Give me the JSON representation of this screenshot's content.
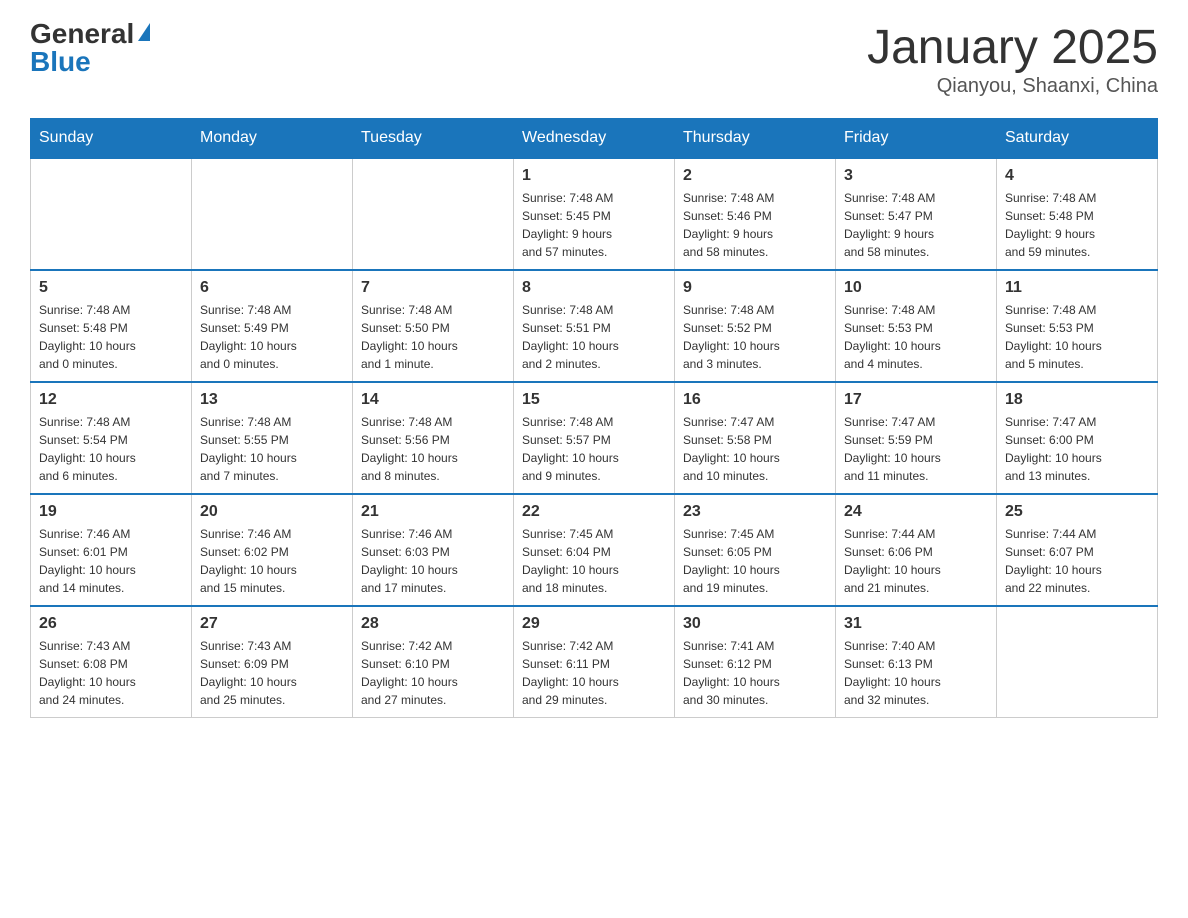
{
  "logo": {
    "general": "General",
    "blue": "Blue"
  },
  "header": {
    "month": "January 2025",
    "location": "Qianyou, Shaanxi, China"
  },
  "days_of_week": [
    "Sunday",
    "Monday",
    "Tuesday",
    "Wednesday",
    "Thursday",
    "Friday",
    "Saturday"
  ],
  "weeks": [
    [
      {
        "day": "",
        "info": ""
      },
      {
        "day": "",
        "info": ""
      },
      {
        "day": "",
        "info": ""
      },
      {
        "day": "1",
        "info": "Sunrise: 7:48 AM\nSunset: 5:45 PM\nDaylight: 9 hours\nand 57 minutes."
      },
      {
        "day": "2",
        "info": "Sunrise: 7:48 AM\nSunset: 5:46 PM\nDaylight: 9 hours\nand 58 minutes."
      },
      {
        "day": "3",
        "info": "Sunrise: 7:48 AM\nSunset: 5:47 PM\nDaylight: 9 hours\nand 58 minutes."
      },
      {
        "day": "4",
        "info": "Sunrise: 7:48 AM\nSunset: 5:48 PM\nDaylight: 9 hours\nand 59 minutes."
      }
    ],
    [
      {
        "day": "5",
        "info": "Sunrise: 7:48 AM\nSunset: 5:48 PM\nDaylight: 10 hours\nand 0 minutes."
      },
      {
        "day": "6",
        "info": "Sunrise: 7:48 AM\nSunset: 5:49 PM\nDaylight: 10 hours\nand 0 minutes."
      },
      {
        "day": "7",
        "info": "Sunrise: 7:48 AM\nSunset: 5:50 PM\nDaylight: 10 hours\nand 1 minute."
      },
      {
        "day": "8",
        "info": "Sunrise: 7:48 AM\nSunset: 5:51 PM\nDaylight: 10 hours\nand 2 minutes."
      },
      {
        "day": "9",
        "info": "Sunrise: 7:48 AM\nSunset: 5:52 PM\nDaylight: 10 hours\nand 3 minutes."
      },
      {
        "day": "10",
        "info": "Sunrise: 7:48 AM\nSunset: 5:53 PM\nDaylight: 10 hours\nand 4 minutes."
      },
      {
        "day": "11",
        "info": "Sunrise: 7:48 AM\nSunset: 5:53 PM\nDaylight: 10 hours\nand 5 minutes."
      }
    ],
    [
      {
        "day": "12",
        "info": "Sunrise: 7:48 AM\nSunset: 5:54 PM\nDaylight: 10 hours\nand 6 minutes."
      },
      {
        "day": "13",
        "info": "Sunrise: 7:48 AM\nSunset: 5:55 PM\nDaylight: 10 hours\nand 7 minutes."
      },
      {
        "day": "14",
        "info": "Sunrise: 7:48 AM\nSunset: 5:56 PM\nDaylight: 10 hours\nand 8 minutes."
      },
      {
        "day": "15",
        "info": "Sunrise: 7:48 AM\nSunset: 5:57 PM\nDaylight: 10 hours\nand 9 minutes."
      },
      {
        "day": "16",
        "info": "Sunrise: 7:47 AM\nSunset: 5:58 PM\nDaylight: 10 hours\nand 10 minutes."
      },
      {
        "day": "17",
        "info": "Sunrise: 7:47 AM\nSunset: 5:59 PM\nDaylight: 10 hours\nand 11 minutes."
      },
      {
        "day": "18",
        "info": "Sunrise: 7:47 AM\nSunset: 6:00 PM\nDaylight: 10 hours\nand 13 minutes."
      }
    ],
    [
      {
        "day": "19",
        "info": "Sunrise: 7:46 AM\nSunset: 6:01 PM\nDaylight: 10 hours\nand 14 minutes."
      },
      {
        "day": "20",
        "info": "Sunrise: 7:46 AM\nSunset: 6:02 PM\nDaylight: 10 hours\nand 15 minutes."
      },
      {
        "day": "21",
        "info": "Sunrise: 7:46 AM\nSunset: 6:03 PM\nDaylight: 10 hours\nand 17 minutes."
      },
      {
        "day": "22",
        "info": "Sunrise: 7:45 AM\nSunset: 6:04 PM\nDaylight: 10 hours\nand 18 minutes."
      },
      {
        "day": "23",
        "info": "Sunrise: 7:45 AM\nSunset: 6:05 PM\nDaylight: 10 hours\nand 19 minutes."
      },
      {
        "day": "24",
        "info": "Sunrise: 7:44 AM\nSunset: 6:06 PM\nDaylight: 10 hours\nand 21 minutes."
      },
      {
        "day": "25",
        "info": "Sunrise: 7:44 AM\nSunset: 6:07 PM\nDaylight: 10 hours\nand 22 minutes."
      }
    ],
    [
      {
        "day": "26",
        "info": "Sunrise: 7:43 AM\nSunset: 6:08 PM\nDaylight: 10 hours\nand 24 minutes."
      },
      {
        "day": "27",
        "info": "Sunrise: 7:43 AM\nSunset: 6:09 PM\nDaylight: 10 hours\nand 25 minutes."
      },
      {
        "day": "28",
        "info": "Sunrise: 7:42 AM\nSunset: 6:10 PM\nDaylight: 10 hours\nand 27 minutes."
      },
      {
        "day": "29",
        "info": "Sunrise: 7:42 AM\nSunset: 6:11 PM\nDaylight: 10 hours\nand 29 minutes."
      },
      {
        "day": "30",
        "info": "Sunrise: 7:41 AM\nSunset: 6:12 PM\nDaylight: 10 hours\nand 30 minutes."
      },
      {
        "day": "31",
        "info": "Sunrise: 7:40 AM\nSunset: 6:13 PM\nDaylight: 10 hours\nand 32 minutes."
      },
      {
        "day": "",
        "info": ""
      }
    ]
  ]
}
